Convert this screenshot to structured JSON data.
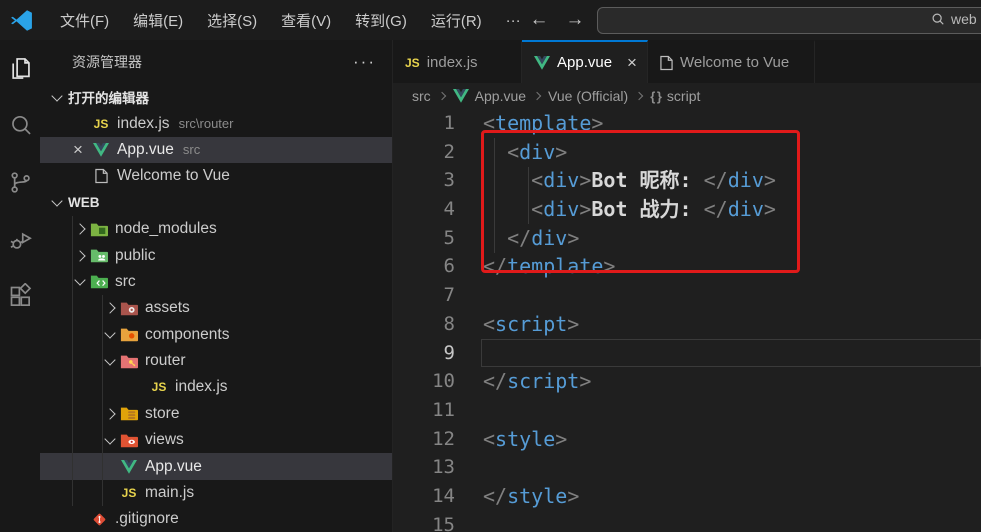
{
  "colors": {
    "accent": "#0078d4",
    "annotation_red": "#e01a1a",
    "selection_bg": "#37373d",
    "editor_bg": "#1f1f1f",
    "sidebar_bg": "#181818"
  },
  "title_bar": {
    "menus": [
      "文件(F)",
      "编辑(E)",
      "选择(S)",
      "查看(V)",
      "转到(G)",
      "运行(R)",
      "···"
    ],
    "back": "←",
    "forward": "→",
    "search": {
      "icon": "search-icon",
      "text": "web"
    }
  },
  "activity_bar": {
    "items": [
      {
        "name": "explorer",
        "active": true
      },
      {
        "name": "search",
        "active": false
      },
      {
        "name": "source-control",
        "active": false
      },
      {
        "name": "run-debug",
        "active": false
      },
      {
        "name": "extensions",
        "active": false
      }
    ]
  },
  "sidebar": {
    "title": "资源管理器",
    "more": "···",
    "open_editors": {
      "header": "打开的编辑器",
      "items": [
        {
          "icon": "js",
          "label": "index.js",
          "desc": "src\\router",
          "selected": false,
          "close": ""
        },
        {
          "icon": "vue",
          "label": "App.vue",
          "desc": "src",
          "selected": true,
          "close": "×"
        },
        {
          "icon": "file",
          "label": "Welcome to Vue",
          "desc": "",
          "selected": false,
          "close": ""
        }
      ]
    },
    "workspace": {
      "header": "WEB",
      "tree": [
        {
          "depth": 1,
          "chevron": "right",
          "icon": "folder-node",
          "label": "node_modules"
        },
        {
          "depth": 1,
          "chevron": "right",
          "icon": "folder-public",
          "label": "public"
        },
        {
          "depth": 1,
          "chevron": "down",
          "icon": "folder-src",
          "label": "src"
        },
        {
          "depth": 2,
          "chevron": "right",
          "icon": "folder-assets",
          "label": "assets"
        },
        {
          "depth": 2,
          "chevron": "down",
          "icon": "folder-components",
          "label": "components"
        },
        {
          "depth": 2,
          "chevron": "down",
          "icon": "folder-router",
          "label": "router"
        },
        {
          "depth": 3,
          "chevron": "",
          "icon": "js",
          "label": "index.js"
        },
        {
          "depth": 2,
          "chevron": "right",
          "icon": "folder-store",
          "label": "store"
        },
        {
          "depth": 2,
          "chevron": "down",
          "icon": "folder-views",
          "label": "views"
        },
        {
          "depth": 2,
          "chevron": "",
          "icon": "vue",
          "label": "App.vue",
          "selected": true
        },
        {
          "depth": 2,
          "chevron": "",
          "icon": "js",
          "label": "main.js"
        },
        {
          "depth": 1,
          "chevron": "",
          "icon": "git",
          "label": ".gitignore"
        }
      ]
    }
  },
  "editor": {
    "tabs": [
      {
        "icon": "js",
        "label": "index.js",
        "active": false,
        "close": "",
        "width": 129
      },
      {
        "icon": "vue",
        "label": "App.vue",
        "active": true,
        "close": "×",
        "width": 126
      },
      {
        "icon": "file",
        "label": "Welcome to Vue",
        "active": false,
        "close": "",
        "width": 167
      }
    ],
    "breadcrumb": [
      {
        "icon": "",
        "label": "src"
      },
      {
        "icon": "vue",
        "label": "App.vue"
      },
      {
        "icon": "",
        "label": "Vue (Official)"
      },
      {
        "icon": "braces",
        "label": "script"
      }
    ],
    "code": {
      "current_line": 9,
      "lines": [
        {
          "num": "1",
          "segs": [
            [
              "p",
              "<"
            ],
            [
              "t",
              "template"
            ],
            [
              "p",
              ">"
            ]
          ]
        },
        {
          "num": "2",
          "segs": [
            [
              "w",
              "  "
            ],
            [
              "p",
              "<"
            ],
            [
              "t",
              "div"
            ],
            [
              "p",
              ">"
            ]
          ]
        },
        {
          "num": "3",
          "segs": [
            [
              "w",
              "    "
            ],
            [
              "p",
              "<"
            ],
            [
              "t",
              "div"
            ],
            [
              "p",
              ">"
            ],
            [
              "w",
              "Bot 昵称: "
            ],
            [
              "p",
              "</"
            ],
            [
              "t",
              "div"
            ],
            [
              "p",
              ">"
            ]
          ]
        },
        {
          "num": "4",
          "segs": [
            [
              "w",
              "    "
            ],
            [
              "p",
              "<"
            ],
            [
              "t",
              "div"
            ],
            [
              "p",
              ">"
            ],
            [
              "w",
              "Bot 战力: "
            ],
            [
              "p",
              "</"
            ],
            [
              "t",
              "div"
            ],
            [
              "p",
              ">"
            ]
          ]
        },
        {
          "num": "5",
          "segs": [
            [
              "w",
              "  "
            ],
            [
              "p",
              "</"
            ],
            [
              "t",
              "div"
            ],
            [
              "p",
              ">"
            ]
          ]
        },
        {
          "num": "6",
          "segs": [
            [
              "p",
              "</"
            ],
            [
              "t",
              "template"
            ],
            [
              "p",
              ">"
            ]
          ]
        },
        {
          "num": "7",
          "segs": []
        },
        {
          "num": "8",
          "segs": [
            [
              "p",
              "<"
            ],
            [
              "t",
              "script"
            ],
            [
              "p",
              ">"
            ]
          ]
        },
        {
          "num": "9",
          "segs": []
        },
        {
          "num": "10",
          "segs": [
            [
              "p",
              "</"
            ],
            [
              "t",
              "script"
            ],
            [
              "p",
              ">"
            ]
          ]
        },
        {
          "num": "11",
          "segs": []
        },
        {
          "num": "12",
          "segs": [
            [
              "p",
              "<"
            ],
            [
              "t",
              "style"
            ],
            [
              "p",
              ">"
            ]
          ]
        },
        {
          "num": "13",
          "segs": []
        },
        {
          "num": "14",
          "segs": [
            [
              "p",
              "</"
            ],
            [
              "t",
              "style"
            ],
            [
              "p",
              ">"
            ]
          ]
        },
        {
          "num": "15",
          "segs": []
        }
      ],
      "annotation": {
        "shape": "rectangle",
        "color": "#e01a1a",
        "around_lines": "2-6"
      }
    }
  }
}
